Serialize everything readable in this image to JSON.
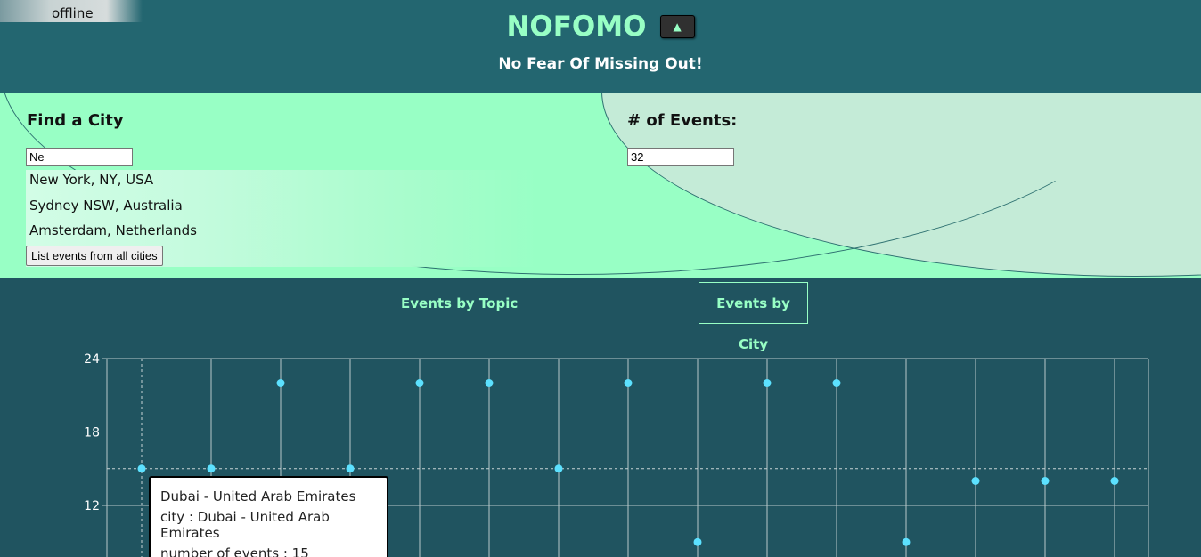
{
  "status": "offline",
  "header": {
    "title": "NOFOMO",
    "toggle_glyph": "▲",
    "subtitle": "No Fear Of Missing Out!"
  },
  "search": {
    "label": "Find a City",
    "value": "Ne",
    "suggestions": [
      "New York, NY, USA",
      "Sydney NSW, Australia",
      "Amsterdam, Netherlands"
    ],
    "all_button": "List events from all cities"
  },
  "events": {
    "label": "# of Events:",
    "value": "32"
  },
  "tabs": {
    "topic": "Events by Topic",
    "city": "Events by City"
  },
  "chart_data": {
    "type": "scatter",
    "y_ticks": [
      "24",
      "18",
      "12"
    ],
    "ylim": [
      8.8,
      24
    ],
    "grid": true,
    "y": [
      15,
      15,
      22,
      15,
      22,
      22,
      15,
      22,
      9,
      22,
      22,
      9,
      14,
      14,
      14
    ],
    "highlight_index": 0,
    "tooltip": {
      "name": "Dubai - United Arab Emirates",
      "city_line": "city : Dubai - United Arab Emirates",
      "events_line": "number of events : 15"
    }
  },
  "colors": {
    "accent": "#98ffc5",
    "header_bg": "#236670",
    "body_bg": "#205460",
    "point": "#5ce1ff"
  }
}
